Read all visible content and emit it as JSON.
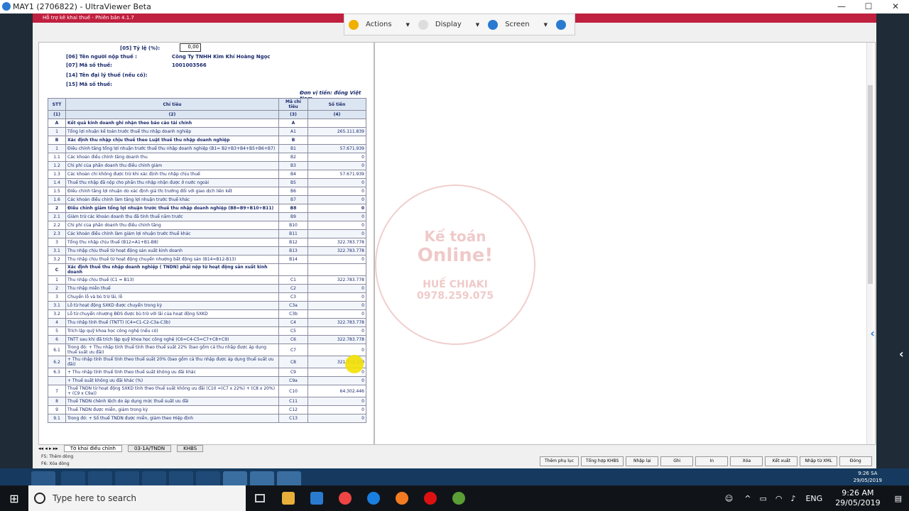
{
  "window": {
    "title": "MAY1 (2706822) - UltraViewer Beta"
  },
  "app": {
    "title": "Hỗ trợ kê khai thuế  -  Phiên bản 4.1.7"
  },
  "uvbar": {
    "actions": "Actions",
    "display": "Display",
    "screen": "Screen"
  },
  "form": {
    "rate_label": "[05] Tỷ lệ (%):",
    "rate_value": "0,00",
    "taxpayer_label": "[06] Tên người nộp thuế :",
    "taxpayer_value": "Công Ty TNHH Kim Khí Hoàng Ngọc",
    "taxcode_label": "[07] Mã số thuế:",
    "taxcode_value": "1001003566",
    "agent_label": "[14] Tên đại lý thuế (nếu có):",
    "agent_code_label": "[15] Mã số thuế:",
    "currency_note": "Đơn vị tiền: đồng Việt Nam"
  },
  "table": {
    "headers": [
      "STT",
      "Chỉ tiêu",
      "Mã chỉ tiêu",
      "Số tiền"
    ],
    "subheaders": [
      "(1)",
      "(2)",
      "(3)",
      "(4)"
    ],
    "rows": [
      {
        "stt": "A",
        "name": "Kết quả kinh doanh ghi nhận theo báo cáo tài chính",
        "code": "A",
        "amount": "",
        "sec": true
      },
      {
        "stt": "1",
        "name": "Tổng lợi nhuận kế toán trước thuế thu nhập doanh nghiệp",
        "code": "A1",
        "amount": "265.111.839"
      },
      {
        "stt": "B",
        "name": "Xác định thu nhập chịu thuế theo Luật thuế thu nhập doanh nghiệp",
        "code": "B",
        "amount": "",
        "sec": true
      },
      {
        "stt": "1",
        "name": "Điều chỉnh tăng tổng lợi nhuận trước thuế thu nhập doanh nghiệp (B1= B2+B3+B4+B5+B6+B7)",
        "code": "B1",
        "amount": "57.671.939"
      },
      {
        "stt": "1.1",
        "name": "Các khoản điều chỉnh tăng doanh thu",
        "code": "B2",
        "amount": "0"
      },
      {
        "stt": "1.2",
        "name": "Chi phí của phần doanh thu điều chỉnh giảm",
        "code": "B3",
        "amount": "0"
      },
      {
        "stt": "1.3",
        "name": "Các khoản chi không được trừ khi xác định thu nhập chịu thuế",
        "code": "B4",
        "amount": "57.671.939"
      },
      {
        "stt": "1.4",
        "name": "Thuế thu nhập đã nộp cho phần thu nhập nhận được ở nước ngoài",
        "code": "B5",
        "amount": "0"
      },
      {
        "stt": "1.5",
        "name": "Điều chỉnh tăng lợi nhuận do xác định giá thị trường đối với giao dịch liên kết",
        "code": "B6",
        "amount": "0"
      },
      {
        "stt": "1.6",
        "name": "Các khoản điều chỉnh làm tăng lợi nhuận trước thuế khác",
        "code": "B7",
        "amount": "0"
      },
      {
        "stt": "2",
        "name": "Điều chỉnh giảm tổng lợi nhuận trước thuế thu nhập doanh nghiệp (B8=B9+B10+B11)",
        "code": "B8",
        "amount": "0",
        "sec": true
      },
      {
        "stt": "2.1",
        "name": "Giảm trừ các khoản doanh thu đã tính thuế năm trước",
        "code": "B9",
        "amount": "0"
      },
      {
        "stt": "2.2",
        "name": "Chi phí của phần doanh thu điều chỉnh tăng",
        "code": "B10",
        "amount": "0"
      },
      {
        "stt": "2.3",
        "name": "Các khoản điều chỉnh làm giảm lợi nhuận trước thuế khác",
        "code": "B11",
        "amount": "0"
      },
      {
        "stt": "3",
        "name": "Tổng thu nhập chịu thuế (B12=A1+B1-B8)",
        "code": "B12",
        "amount": "322.783.778"
      },
      {
        "stt": "3.1",
        "name": "Thu nhập chịu thuế từ hoạt động sản xuất kinh doanh",
        "code": "B13",
        "amount": "322.783.778"
      },
      {
        "stt": "3.2",
        "name": "Thu nhập chịu thuế từ hoạt động chuyển nhượng bất động sản (B14=B12-B13)",
        "code": "B14",
        "amount": "0"
      },
      {
        "stt": "C",
        "name": "Xác định thuế thu nhập doanh nghiệp ( TNDN) phải nộp từ hoạt động sản xuất kinh doanh",
        "code": "",
        "amount": "",
        "sec": true
      },
      {
        "stt": "1",
        "name": "Thu nhập chịu thuế (C1 = B13)",
        "code": "C1",
        "amount": "322.783.778"
      },
      {
        "stt": "2",
        "name": "Thu nhập miễn thuế",
        "code": "C2",
        "amount": "0"
      },
      {
        "stt": "3",
        "name": "Chuyển lỗ và bù trừ lãi, lỗ",
        "code": "C3",
        "amount": "0"
      },
      {
        "stt": "3.1",
        "name": "Lỗ từ hoạt động SXKD được chuyển trong kỳ",
        "code": "C3a",
        "amount": "0"
      },
      {
        "stt": "3.2",
        "name": "Lỗ từ chuyển nhượng BĐS được bù trừ với lãi của hoạt động SXKD",
        "code": "C3b",
        "amount": "0"
      },
      {
        "stt": "4",
        "name": "Thu nhập tính thuế (TNTT) (C4=C1-C2-C3a-C3b)",
        "code": "C4",
        "amount": "322.783.778"
      },
      {
        "stt": "5",
        "name": "Trích lập quỹ khoa học công nghệ (nếu có)",
        "code": "C5",
        "amount": "0"
      },
      {
        "stt": "6",
        "name": "TNTT sau khi đã trích lập quỹ khoa học công nghệ (C6=C4-C5=C7+C8+C9)",
        "code": "C6",
        "amount": "322.783.778"
      },
      {
        "stt": "6.1",
        "name": "Trong đó: + Thu nhập tính thuế tính theo thuế suất 22% (bao gồm cả thu nhập được áp dụng thuế suất ưu đãi)",
        "code": "C7",
        "amount": "0"
      },
      {
        "stt": "6.2",
        "name": "+ Thu nhập tính thuế tính theo thuế suất 20% (bao gồm cả thu nhập được áp dụng thuế suất ưu đãi)",
        "code": "C8",
        "amount": "321.512.230"
      },
      {
        "stt": "6.3",
        "name": "+ Thu nhập tính thuế tính theo thuế suất không ưu đãi khác",
        "code": "C9",
        "amount": "0"
      },
      {
        "stt": "",
        "name": "+ Thuế suất không ưu đãi khác (%)",
        "code": "C9a",
        "amount": "0"
      },
      {
        "stt": "7",
        "name": "Thuế TNDN từ hoạt động SXKD tính theo thuế suất không ưu đãi (C10 =(C7 x 22%) + (C8 x 20%) + (C9 x C9a))",
        "code": "C10",
        "amount": "64.302.446"
      },
      {
        "stt": "8",
        "name": "Thuế TNDN chênh lệch do áp dụng mức thuế suất ưu đãi",
        "code": "C11",
        "amount": "0"
      },
      {
        "stt": "9",
        "name": "Thuế TNDN được miễn, giảm trong kỳ",
        "code": "C12",
        "amount": "0"
      },
      {
        "stt": "9.1",
        "name": "Trong đó: + Số thuế TNDN được miễn, giảm theo Hiệp định",
        "code": "C13",
        "amount": "0"
      }
    ]
  },
  "watermark": {
    "line1": "Kế toán",
    "line2": "Online!",
    "line3": "HUẾ CHIAKI",
    "line4": "0978.259.075"
  },
  "tabs": [
    "Tờ khai điều chỉnh",
    "03-1A/TNDN",
    "KHBS"
  ],
  "fkeys": {
    "f5": "F5: Thêm dòng",
    "f6": "F6: Xóa dòng"
  },
  "buttons": [
    "Thêm phụ lục",
    "Tổng hợp KHBS",
    "Nhập lại",
    "Ghi",
    "In",
    "Xóa",
    "Kết xuất",
    "Nhập từ XML",
    "Đóng"
  ],
  "remote_clock": {
    "time": "9:26 SA",
    "date": "29/05/2019"
  },
  "taskbar": {
    "search_placeholder": "Type here to search",
    "lang": "ENG",
    "time": "9:26 AM",
    "date": "29/05/2019"
  }
}
